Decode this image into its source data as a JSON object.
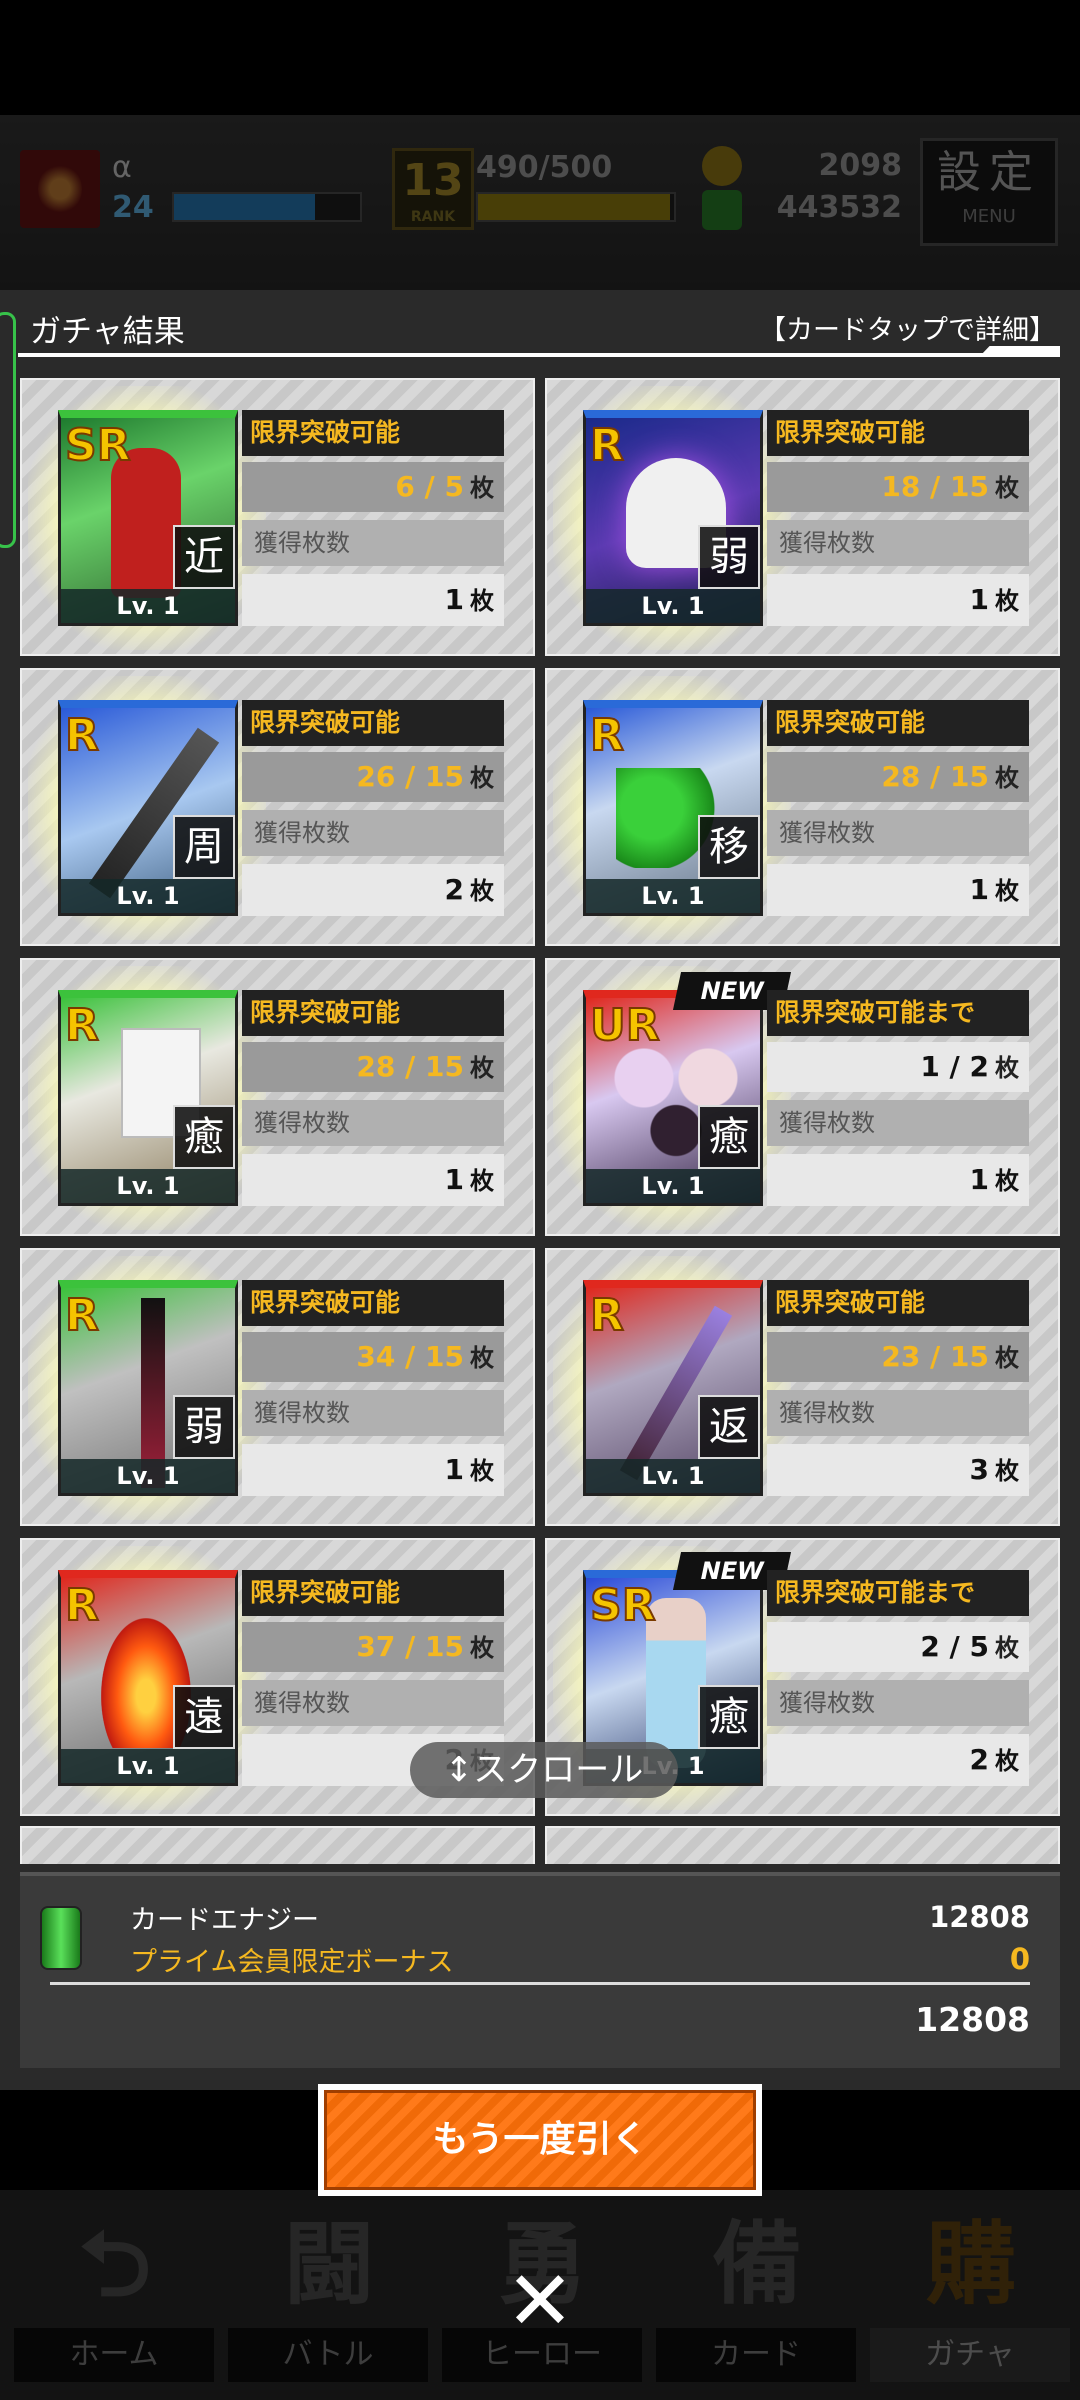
{
  "hud": {
    "player_name": "α",
    "player_level": "24",
    "hp_fraction": 0.76,
    "rank_value": "13",
    "rank_label": "RANK",
    "exp_text": "490/500",
    "exp_fraction": 0.98,
    "coins": "2098",
    "energy": "443532",
    "settings_label": "設定",
    "menu_label": "MENU"
  },
  "modal": {
    "title": "ガチャ結果",
    "hint": "【カードタップで詳細】"
  },
  "cards": [
    {
      "rarity": "SR",
      "type": "近",
      "level": "Lv. 1",
      "status": "限界突破可能",
      "count": "6 / 5",
      "unit": "枚",
      "obtain_label": "獲得枚数",
      "obtain": "1",
      "obtain_unit": "枚",
      "new": false,
      "frame": "green"
    },
    {
      "rarity": "R",
      "type": "弱",
      "level": "Lv. 1",
      "status": "限界突破可能",
      "count": "18 / 15",
      "unit": "枚",
      "obtain_label": "獲得枚数",
      "obtain": "1",
      "obtain_unit": "枚",
      "new": false,
      "frame": "blue"
    },
    {
      "rarity": "R",
      "type": "周",
      "level": "Lv. 1",
      "status": "限界突破可能",
      "count": "26 / 15",
      "unit": "枚",
      "obtain_label": "獲得枚数",
      "obtain": "2",
      "obtain_unit": "枚",
      "new": false,
      "frame": "blue"
    },
    {
      "rarity": "R",
      "type": "移",
      "level": "Lv. 1",
      "status": "限界突破可能",
      "count": "28 / 15",
      "unit": "枚",
      "obtain_label": "獲得枚数",
      "obtain": "1",
      "obtain_unit": "枚",
      "new": false,
      "frame": "blue"
    },
    {
      "rarity": "R",
      "type": "癒",
      "level": "Lv. 1",
      "status": "限界突破可能",
      "count": "28 / 15",
      "unit": "枚",
      "obtain_label": "獲得枚数",
      "obtain": "1",
      "obtain_unit": "枚",
      "new": false,
      "frame": "green"
    },
    {
      "rarity": "UR",
      "type": "癒",
      "level": "Lv. 1",
      "status": "限界突破可能まで",
      "count": "1 / 2",
      "unit": "枚",
      "obtain_label": "獲得枚数",
      "obtain": "1",
      "obtain_unit": "枚",
      "new": true,
      "new_label": "NEW",
      "frame": "red"
    },
    {
      "rarity": "R",
      "type": "弱",
      "level": "Lv. 1",
      "status": "限界突破可能",
      "count": "34 / 15",
      "unit": "枚",
      "obtain_label": "獲得枚数",
      "obtain": "1",
      "obtain_unit": "枚",
      "new": false,
      "frame": "green"
    },
    {
      "rarity": "R",
      "type": "返",
      "level": "Lv. 1",
      "status": "限界突破可能",
      "count": "23 / 15",
      "unit": "枚",
      "obtain_label": "獲得枚数",
      "obtain": "3",
      "obtain_unit": "枚",
      "new": false,
      "frame": "red"
    },
    {
      "rarity": "R",
      "type": "遠",
      "level": "Lv. 1",
      "status": "限界突破可能",
      "count": "37 / 15",
      "unit": "枚",
      "obtain_label": "獲得枚数",
      "obtain": "2",
      "obtain_unit": "枚",
      "new": false,
      "frame": "red"
    },
    {
      "rarity": "SR",
      "type": "癒",
      "level": "Lv. 1",
      "status": "限界突破可能まで",
      "count": "2 / 5",
      "unit": "枚",
      "obtain_label": "獲得枚数",
      "obtain": "2",
      "obtain_unit": "枚",
      "new": true,
      "new_label": "NEW",
      "frame": "blue"
    }
  ],
  "scroll_hint": "↕スクロール",
  "energy": {
    "label": "カードエナジー",
    "bonus_label": "プライム会員限定ボーナス",
    "amount": "12808",
    "bonus_amount": "0",
    "total": "12808"
  },
  "draw_again_label": "もう一度引く",
  "nav": [
    {
      "label": "ホーム",
      "glyph": "⮌"
    },
    {
      "label": "バトル",
      "glyph": "闘"
    },
    {
      "label": "ヒーロー",
      "glyph": "勇"
    },
    {
      "label": "カード",
      "glyph": "備"
    },
    {
      "label": "ガチャ",
      "glyph": "購"
    }
  ],
  "close_glyph": "✕",
  "colors": {
    "accent_orange": "#f07a1a",
    "status_gold": "#f5b820",
    "frame_green": "#3cc23c",
    "frame_blue": "#2a6ad8",
    "frame_red": "#e0281e"
  }
}
